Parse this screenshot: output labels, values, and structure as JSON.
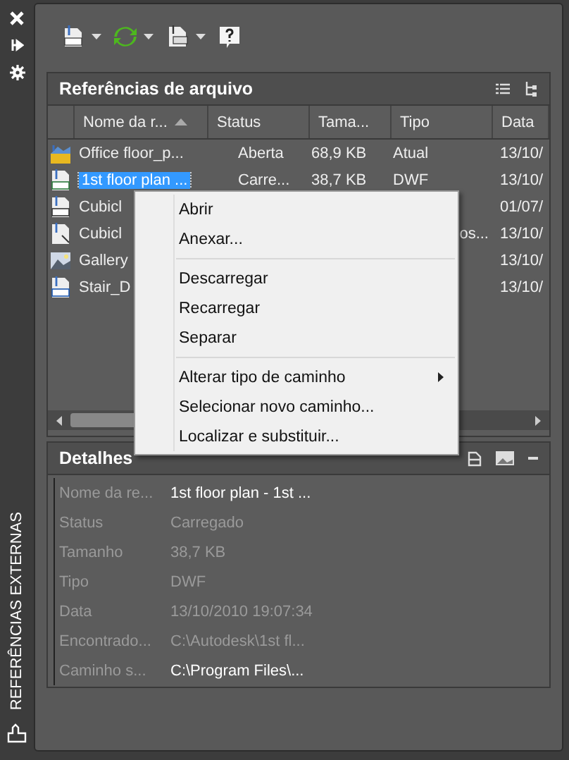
{
  "palette": {
    "vertical_title": "REFERÊNCIAS EXTERNAS"
  },
  "file_references": {
    "title": "Referências de arquivo",
    "columns": [
      {
        "label": "Nome da r...",
        "sorted": true
      },
      {
        "label": "Status",
        "sorted": false
      },
      {
        "label": "Tama...",
        "sorted": false
      },
      {
        "label": "Tipo",
        "sorted": false
      },
      {
        "label": "Data",
        "sorted": false
      }
    ],
    "rows": [
      {
        "kind": "drawing",
        "name": "Office floor_p...",
        "status": "Aberta",
        "size": "68,9 KB",
        "type": "Atual",
        "date": "13/10/",
        "selected": false
      },
      {
        "kind": "dwf",
        "name": "1st floor plan ...",
        "status": "Carre...",
        "size": "38,7 KB",
        "type": "DWF",
        "date": "13/10/",
        "selected": true
      },
      {
        "kind": "dwg",
        "name": "Cubicl",
        "date": "01/07/",
        "selected": false
      },
      {
        "kind": "pdf",
        "name": "Cubicl",
        "type": "os...",
        "type_cut": true,
        "date": "13/10/",
        "selected": false
      },
      {
        "kind": "image",
        "name": "Gallery",
        "date": "13/10/",
        "selected": false
      },
      {
        "kind": "dgn",
        "name": "Stair_D",
        "date": "13/10/",
        "selected": false
      }
    ]
  },
  "context_menu": [
    {
      "kind": "item",
      "label": "Abrir"
    },
    {
      "kind": "item",
      "label": "Anexar..."
    },
    {
      "kind": "separator"
    },
    {
      "kind": "item",
      "label": "Descarregar"
    },
    {
      "kind": "item",
      "label": "Recarregar"
    },
    {
      "kind": "item",
      "label": "Separar"
    },
    {
      "kind": "separator"
    },
    {
      "kind": "submenu",
      "label": "Alterar tipo de caminho"
    },
    {
      "kind": "item",
      "label": "Selecionar novo caminho..."
    },
    {
      "kind": "item",
      "label": "Localizar e substituir..."
    }
  ],
  "details": {
    "title": "Detalhes",
    "rows": [
      {
        "label": "Nome da re...",
        "value": "1st floor plan - 1st ...",
        "emphasis": true
      },
      {
        "label": "Status",
        "value": "Carregado",
        "emphasis": false
      },
      {
        "label": "Tamanho",
        "value": "38,7 KB",
        "emphasis": false
      },
      {
        "label": "Tipo",
        "value": "DWF",
        "emphasis": false
      },
      {
        "label": "Data",
        "value": "13/10/2010 19:07:34",
        "emphasis": false
      },
      {
        "label": "Encontrado...",
        "value": "C:\\Autodesk\\1st fl...",
        "emphasis": false
      },
      {
        "label": "Caminho s...",
        "value": "C:\\Program Files\\...",
        "emphasis": true
      }
    ]
  }
}
